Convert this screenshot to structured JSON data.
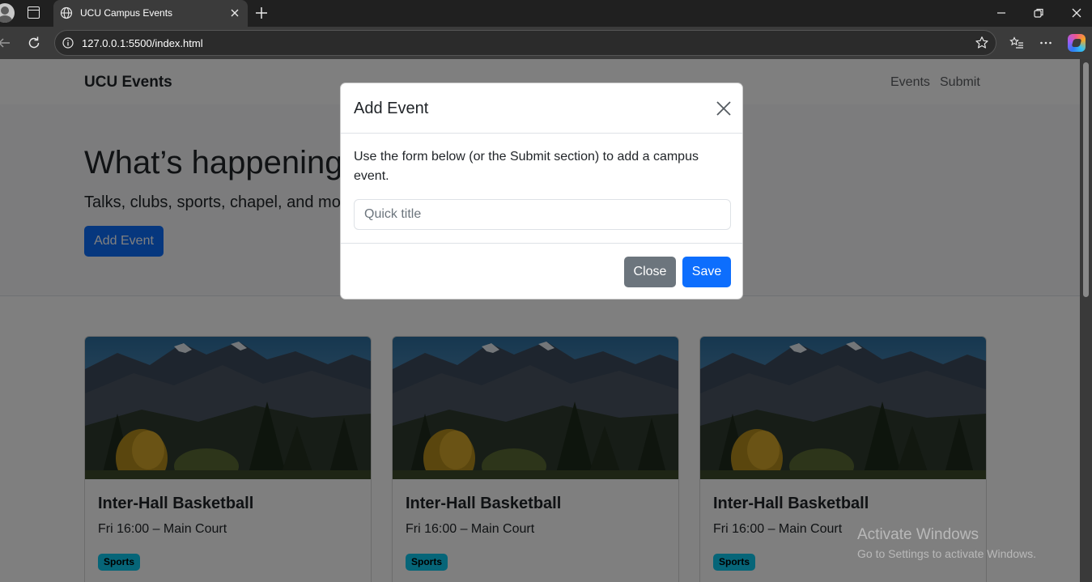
{
  "browser": {
    "tab_title": "UCU Campus Events",
    "url": "127.0.0.1:5500/index.html"
  },
  "navbar": {
    "brand": "UCU Events",
    "links": [
      "Events",
      "Submit"
    ]
  },
  "hero": {
    "title": "What’s happening on campus",
    "subtitle": "Talks, clubs, sports, chapel, and more—all in one place.",
    "button_label": "Add Event"
  },
  "events": [
    {
      "title": "Inter-Hall Basketball",
      "when_where": "Fri 16:00 – Main Court",
      "badge": "Sports",
      "image": "mountain-landscape"
    },
    {
      "title": "Inter-Hall Basketball",
      "when_where": "Fri 16:00 – Main Court",
      "badge": "Sports",
      "image": "mountain-landscape"
    },
    {
      "title": "Inter-Hall Basketball",
      "when_where": "Fri 16:00 – Main Court",
      "badge": "Sports",
      "image": "mountain-landscape"
    }
  ],
  "modal": {
    "title": "Add Event",
    "body": "Use the form below (or the Submit section) to add a campus event.",
    "input_placeholder": "Quick title",
    "input_value": "",
    "close_label": "Close",
    "save_label": "Save"
  },
  "watermark": {
    "title": "Activate Windows",
    "subtitle": "Go to Settings to activate Windows."
  },
  "colors": {
    "primary": "#0d6efd",
    "secondary": "#6c757d",
    "badge_info": "#0dcaf0"
  }
}
